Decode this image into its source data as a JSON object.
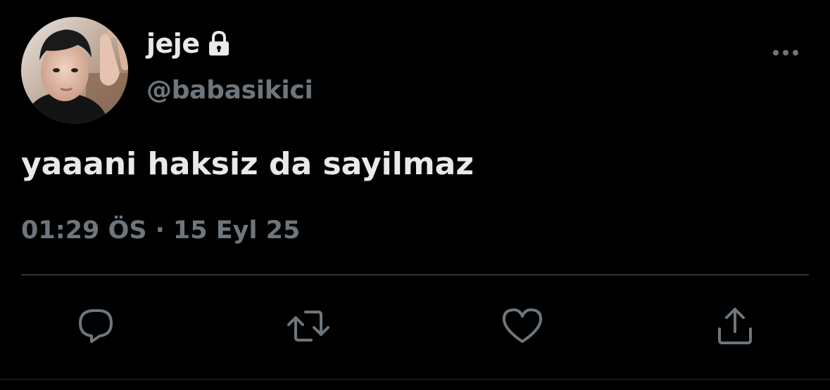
{
  "user": {
    "display_name": "jeje",
    "handle": "@babasikici",
    "protected_icon": "lock-icon",
    "avatar_icon": "profile-photo"
  },
  "tweet": {
    "text": "yaaani haksiz da sayilmaz",
    "time": "01:29 ÖS",
    "separator": "·",
    "date": "15 Eyl 25"
  },
  "menu": {
    "icon": "more-horizontal-icon"
  },
  "actions": [
    {
      "name": "reply",
      "icon": "reply-icon"
    },
    {
      "name": "retweet",
      "icon": "retweet-icon"
    },
    {
      "name": "like",
      "icon": "heart-icon"
    },
    {
      "name": "share",
      "icon": "share-icon"
    }
  ],
  "colors": {
    "background": "#000000",
    "primary_text": "#e7e9ea",
    "secondary_text": "#6e767d",
    "divider": "#2f3336"
  }
}
